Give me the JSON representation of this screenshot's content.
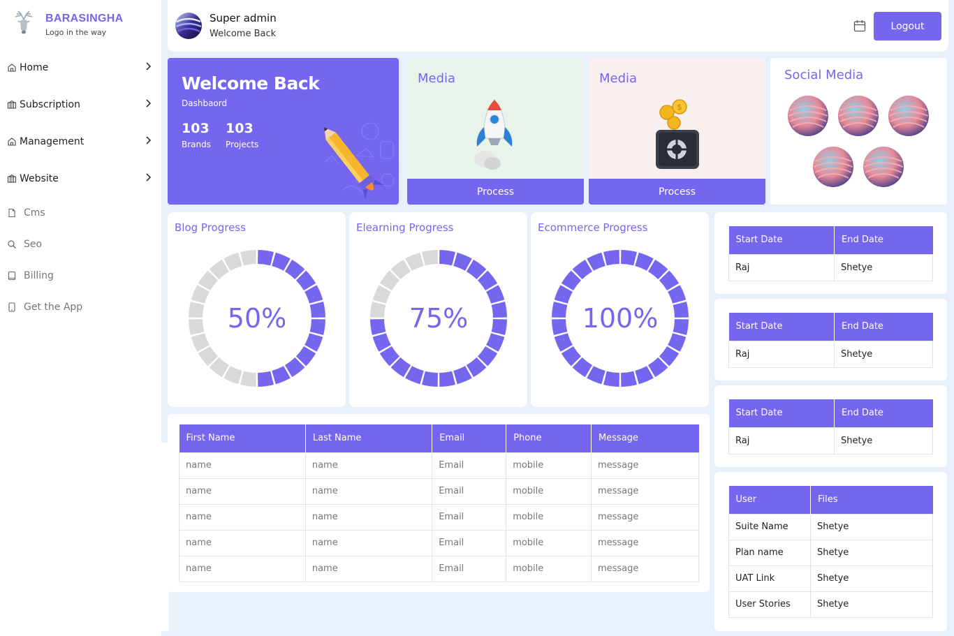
{
  "sidebar": {
    "brand_name": "BARASINGHA",
    "brand_tagline": "Logo in the way",
    "nav_groups": [
      {
        "label": "Home"
      },
      {
        "label": "Subscription"
      },
      {
        "label": "Management"
      },
      {
        "label": "Website"
      }
    ],
    "nav_links": [
      {
        "label": "Cms",
        "icon": "file-icon"
      },
      {
        "label": "Seo",
        "icon": "search-icon"
      },
      {
        "label": "Billing",
        "icon": "book-icon"
      },
      {
        "label": "Get the App",
        "icon": "mobile-icon"
      }
    ]
  },
  "header": {
    "user_title": "Super admin",
    "user_subtitle": "Welcome Back",
    "logout_label": "Logout"
  },
  "welcome": {
    "title": "Welcome Back",
    "subtitle": "Dashbaord",
    "stats": [
      {
        "value": "103",
        "label": "Brands"
      },
      {
        "value": "103",
        "label": "Projects"
      }
    ]
  },
  "media_cards": [
    {
      "title": "Media",
      "button": "Process",
      "bg": "#e8f3ea"
    },
    {
      "title": "Media",
      "button": "Process",
      "bg": "#f9efef"
    }
  ],
  "social": {
    "title": "Social Media"
  },
  "progress": [
    {
      "title": "Blog Progress",
      "value_label": "50%",
      "fraction": 0.5
    },
    {
      "title": "Elearning Progress",
      "value_label": "75%",
      "fraction": 0.75
    },
    {
      "title": "Ecommerce Progress",
      "value_label": "100%",
      "fraction": 1.0
    }
  ],
  "contacts_table": {
    "headers": [
      "First Name",
      "Last Name",
      "Email",
      "Phone",
      "Message"
    ],
    "rows": [
      [
        "name",
        "name",
        "Email",
        "mobile",
        "message"
      ],
      [
        "name",
        "name",
        "Email",
        "mobile",
        "message"
      ],
      [
        "name",
        "name",
        "Email",
        "mobile",
        "message"
      ],
      [
        "name",
        "name",
        "Email",
        "mobile",
        "message"
      ],
      [
        "name",
        "name",
        "Email",
        "mobile",
        "message"
      ]
    ]
  },
  "date_tables": [
    {
      "headers": [
        "Start Date",
        "End Date"
      ],
      "rows": [
        [
          "Raj",
          "Shetye"
        ]
      ]
    },
    {
      "headers": [
        "Start Date",
        "End Date"
      ],
      "rows": [
        [
          "Raj",
          "Shetye"
        ]
      ]
    },
    {
      "headers": [
        "Start Date",
        "End Date"
      ],
      "rows": [
        [
          "Raj",
          "Shetye"
        ]
      ]
    }
  ],
  "files_table": {
    "headers": [
      "User",
      "Files"
    ],
    "rows": [
      [
        "Suite Name",
        "Shetye"
      ],
      [
        "Plan name",
        "Shetye"
      ],
      [
        "UAT Link",
        "Shetye"
      ],
      [
        "User Stories",
        "Shetye"
      ]
    ]
  },
  "colors": {
    "accent": "#7466ee",
    "track": "#d9d9d9",
    "page_bg": "#e8f1fb"
  }
}
